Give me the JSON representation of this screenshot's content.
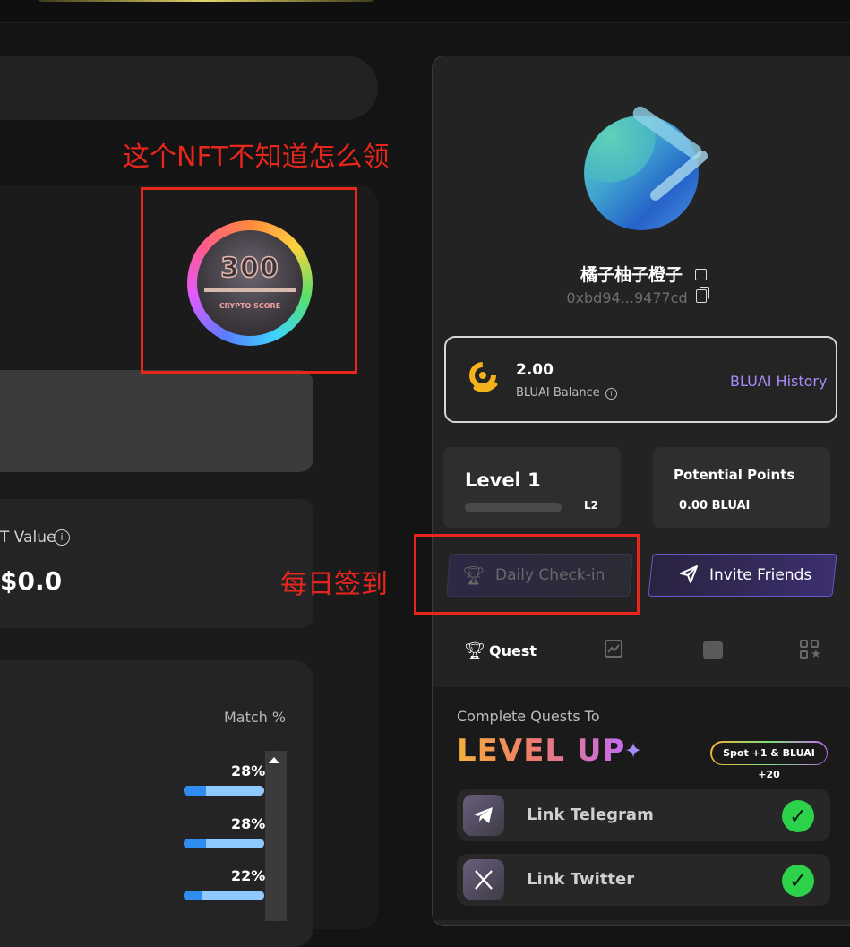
{
  "annotations": {
    "nft_question": "这个NFT不知道怎么领",
    "checkin": "每日签到"
  },
  "left": {
    "value_label": "T Value",
    "value_amount": "$0.0",
    "match_header": "Match %",
    "match_rows": [
      {
        "pct": "28%",
        "fill": 0.28
      },
      {
        "pct": "28%",
        "fill": 0.28
      },
      {
        "pct": "22%",
        "fill": 0.22
      }
    ]
  },
  "nft": {
    "number": "300",
    "subtitle": "CRYPTO SCORE"
  },
  "profile": {
    "username": "橘子柚子橙子",
    "wallet": "0xbd94...9477cd"
  },
  "balance": {
    "value": "2.00",
    "label": "BLUAI Balance",
    "history_link": "BLUAI History"
  },
  "level": {
    "label": "Level 1",
    "next": "L2",
    "progress": 0
  },
  "points": {
    "label": "Potential Points",
    "value": "0.00 BLUAI"
  },
  "buttons": {
    "checkin": "Daily Check-in",
    "invite": "Invite Friends"
  },
  "tabs": {
    "quest": "Quest"
  },
  "quests": {
    "subtitle": "Complete Quests To",
    "title": "LEVEL UP",
    "reward": "Spot +1 & BLUAI +20",
    "items": [
      {
        "label": "Link Telegram",
        "done": true
      },
      {
        "label": "Link Twitter",
        "done": true
      }
    ]
  },
  "colors": {
    "annotation_red": "#e8261c",
    "accent_purple": "#a78bfa",
    "check_green": "#2bd24a"
  }
}
